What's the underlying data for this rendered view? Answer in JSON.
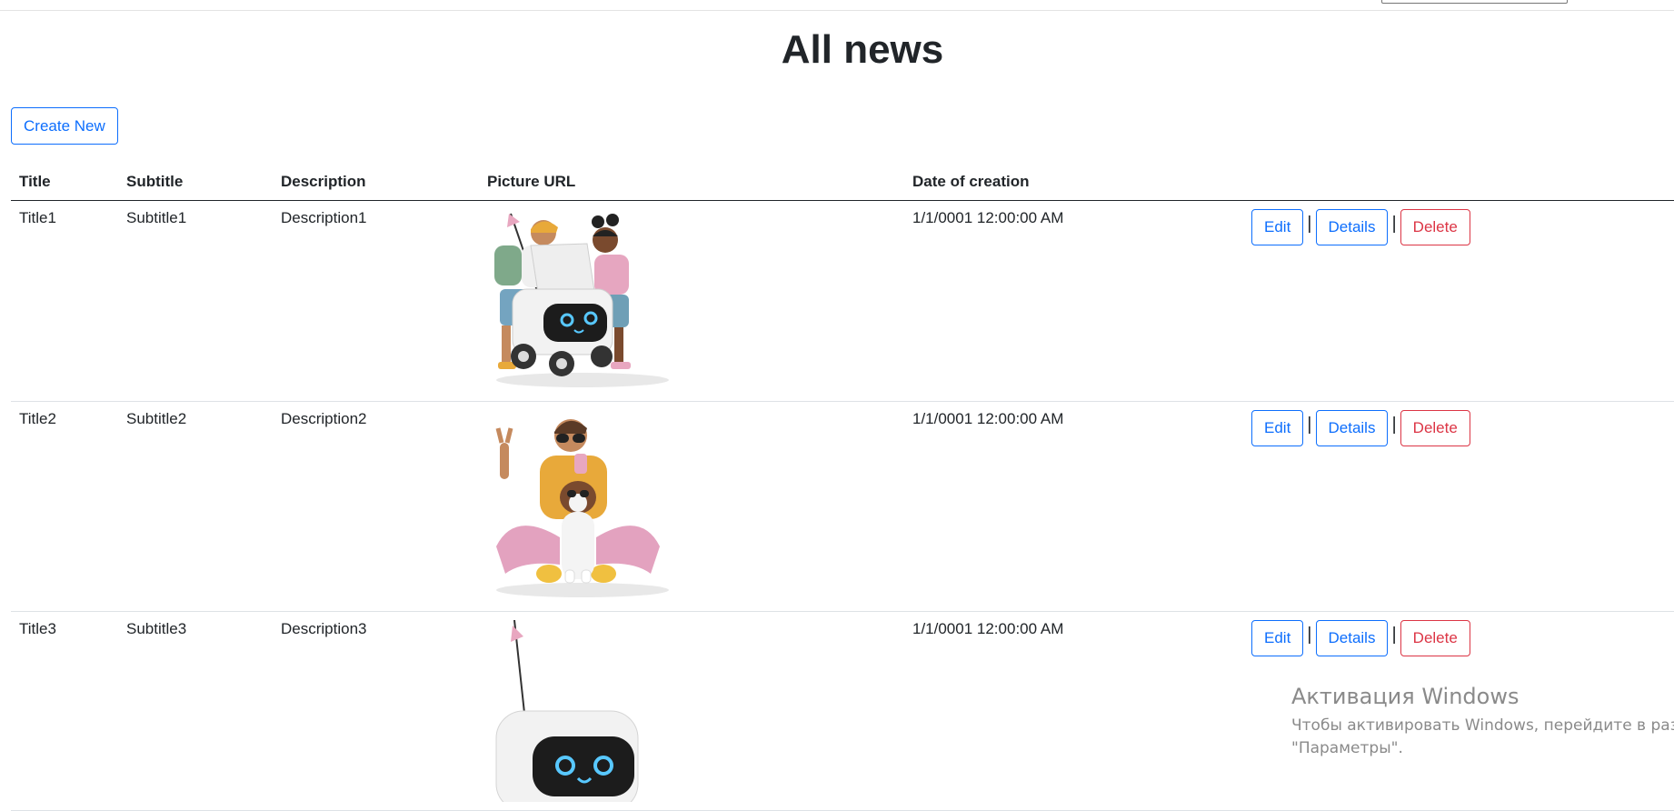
{
  "header": {
    "title": "All news"
  },
  "toolbar": {
    "create_label": "Create New"
  },
  "table": {
    "columns": [
      "Title",
      "Subtitle",
      "Description",
      "Picture URL",
      "Date of creation"
    ],
    "rows": [
      {
        "title": "Title1",
        "subtitle": "Subtitle1",
        "description": "Description1",
        "picture_icon": "delivery-robot-with-two-kids-image",
        "date": "1/1/0001 12:00:00 AM"
      },
      {
        "title": "Title2",
        "subtitle": "Subtitle2",
        "description": "Description2",
        "picture_icon": "person-with-dog-image",
        "date": "1/1/0001 12:00:00 AM"
      },
      {
        "title": "Title3",
        "subtitle": "Subtitle3",
        "description": "Description3",
        "picture_icon": "delivery-robot-image",
        "date": "1/1/0001 12:00:00 AM"
      }
    ],
    "actions": {
      "edit": "Edit",
      "details": "Details",
      "delete": "Delete",
      "separator": "|"
    }
  },
  "watermark": {
    "title": "Активация Windows",
    "line1": "Чтобы активировать Windows, перейдите в раздел",
    "line2": "\"Параметры\"."
  },
  "colors": {
    "primary": "#0d6efd",
    "danger": "#dc3545",
    "text": "#212529",
    "watermark": "#8a8a8a"
  }
}
